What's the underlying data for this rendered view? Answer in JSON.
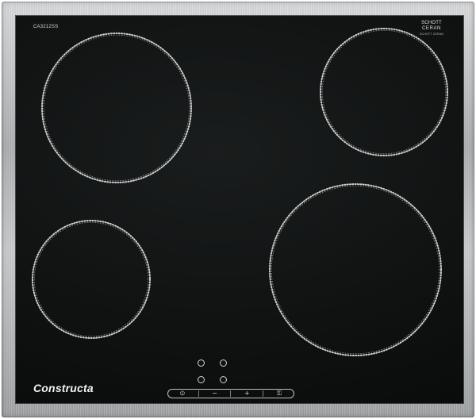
{
  "hob": {
    "model_code": "CA3212SS",
    "schott": {
      "line1": "SCHOTT",
      "line2": "CERAN",
      "line3": "SCHOTT CERAN"
    },
    "brand": "Constructa"
  },
  "controls": {
    "power_symbol": "⦶",
    "minus_symbol": "−",
    "plus_symbol": "+",
    "key_symbol": "⚿"
  },
  "icons": {
    "power": "power-icon",
    "minus": "minus-icon",
    "plus": "plus-icon",
    "key": "child-lock-key-icon"
  },
  "colors": {
    "glass": "#0f1111",
    "steel": "#b8babc",
    "print": "#d7d7d7"
  }
}
